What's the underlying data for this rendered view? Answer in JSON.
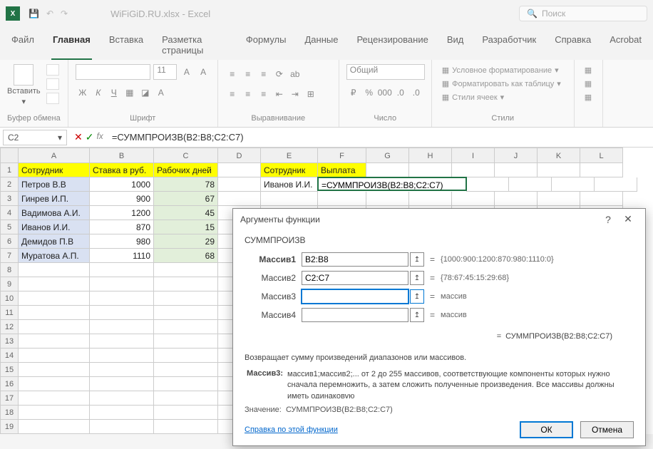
{
  "titlebar": {
    "app_initial": "X",
    "filename": "WiFiGiD.RU.xlsx - Excel",
    "search_placeholder": "Поиск"
  },
  "tabs": {
    "items": [
      "Файл",
      "Главная",
      "Вставка",
      "Разметка страницы",
      "Формулы",
      "Данные",
      "Рецензирование",
      "Вид",
      "Разработчик",
      "Справка",
      "Acrobat"
    ],
    "active_index": 1
  },
  "ribbon": {
    "clipboard": {
      "label": "Буфер обмена",
      "paste": "Вставить"
    },
    "font": {
      "label": "Шрифт",
      "size": "11",
      "bold": "Ж",
      "italic": "К",
      "underline": "Ч"
    },
    "alignment": {
      "label": "Выравнивание"
    },
    "number": {
      "label": "Число",
      "format": "Общий"
    },
    "styles": {
      "label": "Стили",
      "cond_format": "Условное форматирование",
      "as_table": "Форматировать как таблицу",
      "cell_styles": "Стили ячеек"
    }
  },
  "namebox": "C2",
  "formula": "=СУММПРОИЗВ(B2:B8;C2:C7)",
  "columns": [
    "A",
    "B",
    "C",
    "D",
    "E",
    "F",
    "G",
    "H",
    "I",
    "J",
    "K",
    "L"
  ],
  "headers": {
    "a": "Сотрудник",
    "b": "Ставка в руб.",
    "c": "Рабочих дней",
    "e": "Сотрудник",
    "f": "Выплата"
  },
  "rows": [
    {
      "a": "Петров В.В",
      "b": "1000",
      "c": "78"
    },
    {
      "a": "Гинрев И.П.",
      "b": "900",
      "c": "67"
    },
    {
      "a": "Вадимова А.И.",
      "b": "1200",
      "c": "45"
    },
    {
      "a": "Иванов И.И.",
      "b": "870",
      "c": "15"
    },
    {
      "a": "Демидов П.В",
      "b": "980",
      "c": "29"
    },
    {
      "a": "Муратова А.П.",
      "b": "1110",
      "c": "68"
    }
  ],
  "e2": "Иванов И.И.",
  "f2": "=СУММПРОИЗВ(B2:B8;C2:C7)",
  "dialog": {
    "title": "Аргументы функции",
    "func": "СУММПРОИЗВ",
    "args": [
      {
        "label": "Массив1",
        "value": "B2:B8",
        "result": "{1000:900:1200:870:980:1110:0}",
        "bold": true
      },
      {
        "label": "Массив2",
        "value": "C2:C7",
        "result": "{78:67:45:15:29:68}",
        "bold": false
      },
      {
        "label": "Массив3",
        "value": "",
        "result": "массив",
        "bold": false
      },
      {
        "label": "Массив4",
        "value": "",
        "result": "массив",
        "bold": false
      }
    ],
    "result_formula": "СУММПРОИЗВ(B2:B8;C2:C7)",
    "desc": "Возвращает сумму произведений диапазонов или массивов.",
    "arg_detail_label": "Массив3:",
    "arg_detail": "массив1;массив2;... от 2 до 255 массивов, соответствующие компоненты которых нужно сначала перемножить, а затем сложить полученные произведения. Все массивы должны иметь одинаковую",
    "value_label": "Значение:",
    "value": "СУММПРОИЗВ(B2:B8;C2:C7)",
    "help_link": "Справка по этой функции",
    "ok": "ОК",
    "cancel": "Отмена"
  }
}
